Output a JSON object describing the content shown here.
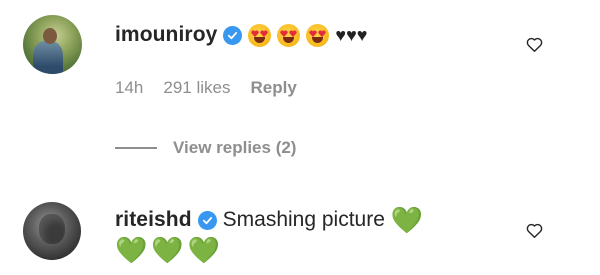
{
  "comments": [
    {
      "username": "imouniroy",
      "verified": true,
      "emojis": [
        "smiling-face-with-heart-eyes",
        "smiling-face-with-heart-eyes",
        "smiling-face-with-heart-eyes"
      ],
      "black_hearts": "♥♥♥",
      "time": "14h",
      "likes": "291 likes",
      "reply_label": "Reply",
      "view_replies": "View replies (2)"
    },
    {
      "username": "riteishd",
      "verified": true,
      "text": "Smashing picture",
      "trailing_heart": "💚",
      "second_line_hearts": [
        "💚",
        "💚",
        "💚"
      ]
    }
  ],
  "colors": {
    "verified_badge": "#3897f0",
    "muted_text": "#8e8e8e",
    "primary_text": "#262626",
    "green_heart": "#2fb52f"
  },
  "icons": {
    "like": "heart-outline-icon",
    "verified": "verified-badge-icon"
  }
}
